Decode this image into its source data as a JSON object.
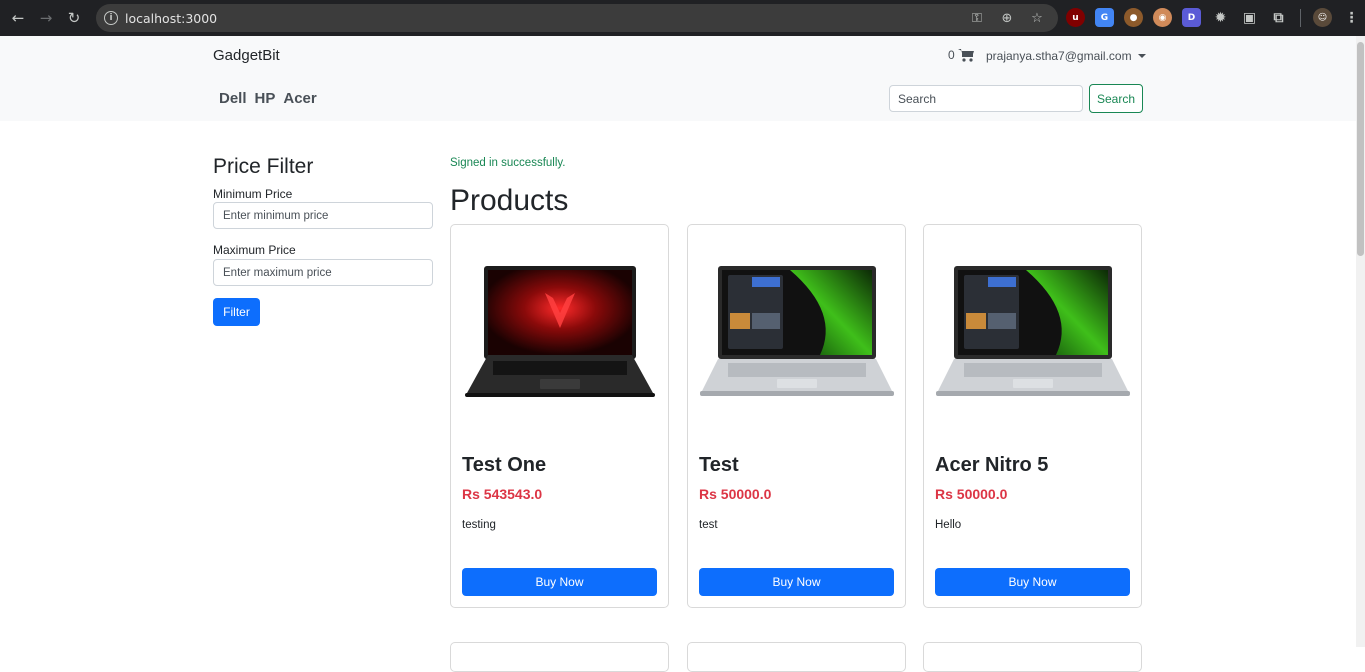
{
  "browser": {
    "url": "localhost:3000"
  },
  "navbar": {
    "brand": "GadgetBit",
    "cart_count": "0",
    "user_email": "prajanya.stha7@gmail.com",
    "brand_links": [
      "Dell",
      "HP",
      "Acer"
    ],
    "search": {
      "placeholder": "Search",
      "button_label": "Search"
    }
  },
  "sidebar": {
    "title": "Price Filter",
    "min_label": "Minimum Price",
    "min_placeholder": "Enter minimum price",
    "max_label": "Maximum Price",
    "max_placeholder": "Enter maximum price",
    "button_label": "Filter"
  },
  "main": {
    "flash": "Signed in successfully.",
    "title": "Products",
    "products": [
      {
        "name": "Test One",
        "price": "Rs 543543.0",
        "description": "testing",
        "button": "Buy Now",
        "image": "laptop-dark-red-screen"
      },
      {
        "name": "Test",
        "price": "Rs 50000.0",
        "description": "test",
        "button": "Buy Now",
        "image": "laptop-silver-green-screen"
      },
      {
        "name": "Acer Nitro 5",
        "price": "Rs 50000.0",
        "description": "Hello",
        "button": "Buy Now",
        "image": "laptop-silver-green-screen"
      }
    ]
  },
  "colors": {
    "primary": "#0d6efd",
    "success": "#198754",
    "danger": "#dc3545",
    "navbar_bg": "#f8f9fa"
  }
}
